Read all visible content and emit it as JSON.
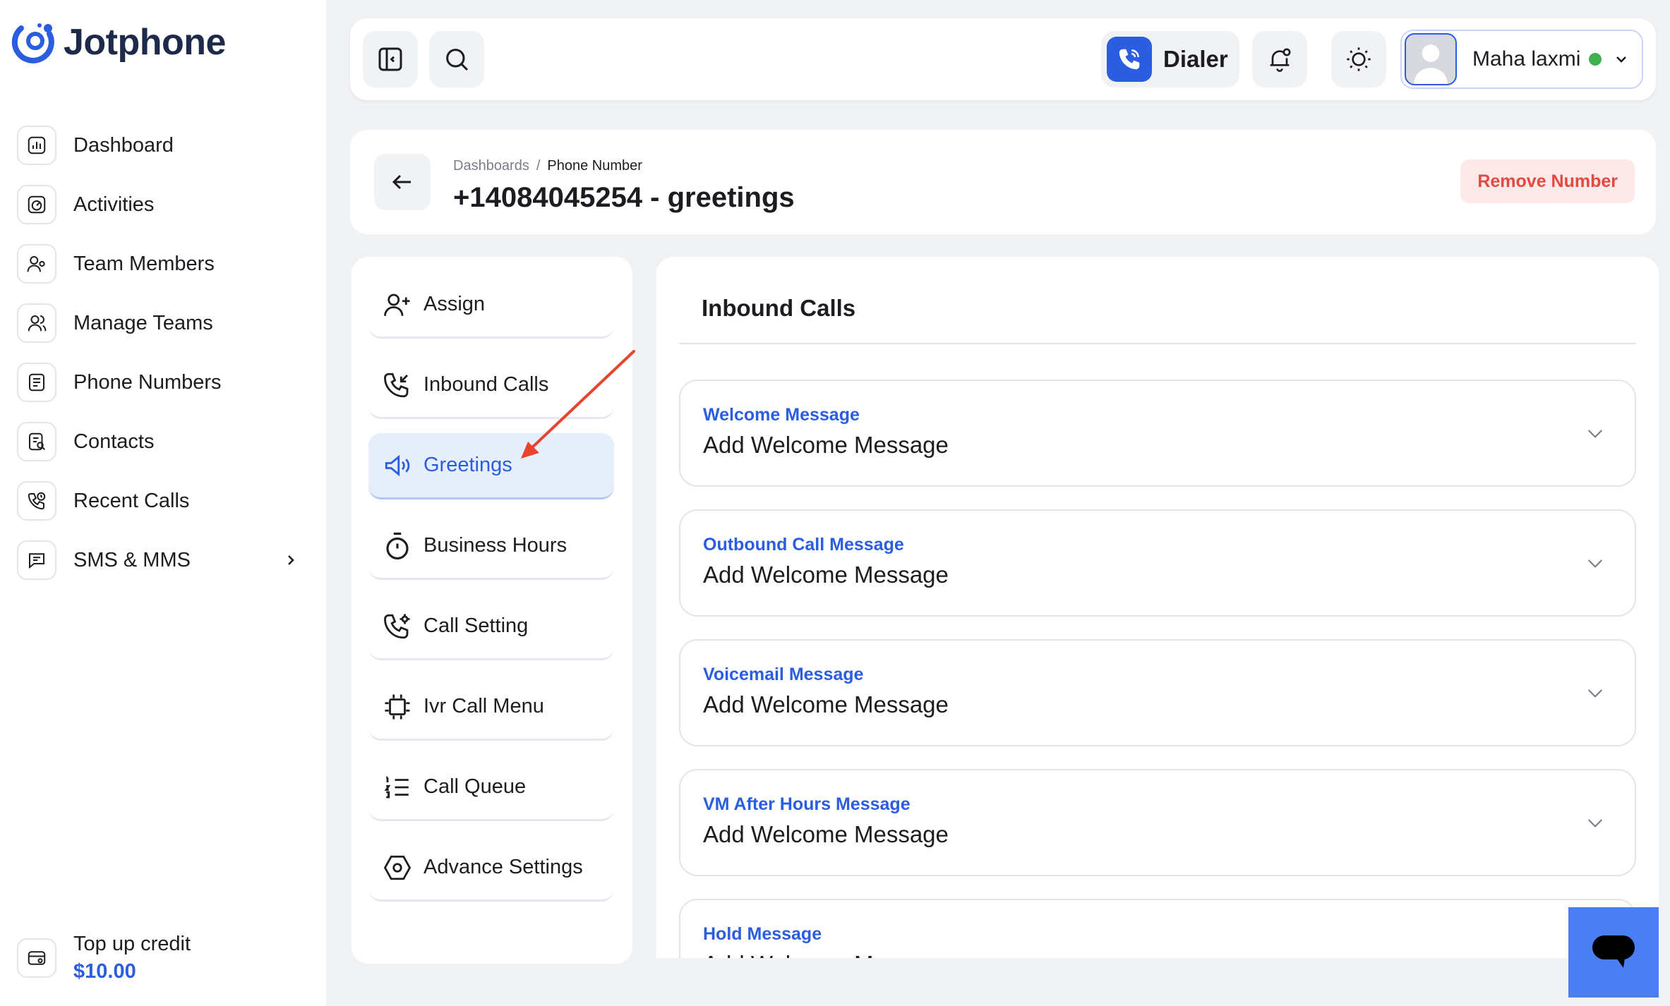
{
  "app": {
    "name": "Jotphone"
  },
  "sidebar": {
    "items": [
      {
        "label": "Dashboard",
        "icon": "dashboard-icon"
      },
      {
        "label": "Activities",
        "icon": "activities-icon"
      },
      {
        "label": "Team Members",
        "icon": "team-members-icon"
      },
      {
        "label": "Manage Teams",
        "icon": "manage-teams-icon"
      },
      {
        "label": "Phone Numbers",
        "icon": "phone-numbers-icon"
      },
      {
        "label": "Contacts",
        "icon": "contacts-icon"
      },
      {
        "label": "Recent Calls",
        "icon": "recent-calls-icon"
      },
      {
        "label": "SMS & MMS",
        "icon": "sms-icon"
      }
    ],
    "topup": {
      "label": "Top up credit",
      "amount": "$10.00"
    }
  },
  "topbar": {
    "dialer_label": "Dialer",
    "user_name": "Maha laxmi",
    "status_color": "#3fb24f"
  },
  "header": {
    "breadcrumb": [
      "Dashboards",
      "Phone Number"
    ],
    "title": "+14084045254 - greetings",
    "remove_label": "Remove Number"
  },
  "menu": {
    "items": [
      {
        "label": "Assign",
        "icon": "user-plus-icon"
      },
      {
        "label": "Inbound Calls",
        "icon": "incoming-call-icon"
      },
      {
        "label": "Greetings",
        "icon": "megaphone-icon",
        "active": true
      },
      {
        "label": "Business Hours",
        "icon": "stopwatch-icon"
      },
      {
        "label": "Call Setting",
        "icon": "call-settings-icon"
      },
      {
        "label": "Ivr Call Menu",
        "icon": "ivr-menu-icon"
      },
      {
        "label": "Call Queue",
        "icon": "numbered-list-icon"
      },
      {
        "label": "Advance Settings",
        "icon": "hexagon-settings-icon"
      }
    ]
  },
  "content": {
    "title": "Inbound Calls",
    "messages": [
      {
        "label": "Welcome Message",
        "value": "Add Welcome Message"
      },
      {
        "label": "Outbound Call Message",
        "value": "Add Welcome Message"
      },
      {
        "label": "Voicemail Message",
        "value": "Add Welcome Message"
      },
      {
        "label": "VM After Hours Message",
        "value": "Add Welcome Message"
      },
      {
        "label": "Hold Message",
        "value": "Add Welcome Message"
      }
    ]
  },
  "colors": {
    "accent": "#2b5de0",
    "danger": "#e5483f",
    "annotation_arrow": "#e8432d"
  }
}
